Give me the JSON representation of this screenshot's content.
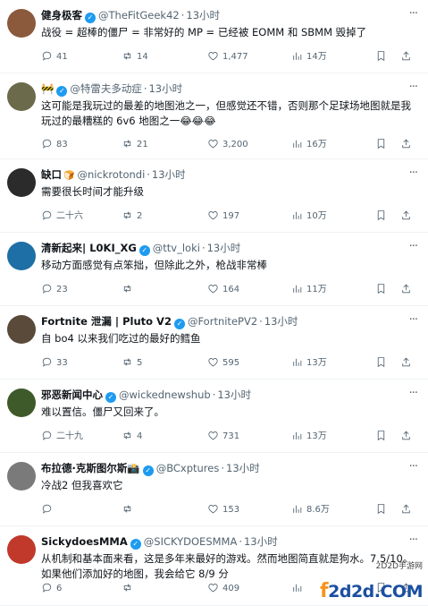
{
  "tweets": [
    {
      "name": "健身极客",
      "verified": true,
      "badge": "",
      "handle": "@TheFitGeek42",
      "time": "13小时",
      "text": "战役 = 超棒的僵尸 = 非常好的 MP = 已经被 EOMM 和 SBMM 毁掉了",
      "replies": "41",
      "retweets": "14",
      "likes": "1,477",
      "views": "14万",
      "avatar_color": "#8b5a3c"
    },
    {
      "name": "🚧",
      "verified": true,
      "badge": "",
      "handle": "@特雷夫多动症",
      "time": "13小时",
      "text": "这可能是我玩过的最差的地图池之一，但感觉还不错，否则那个足球场地图就是我玩过的最糟糕的 6v6 地图之一😂😂😂",
      "replies": "83",
      "retweets": "21",
      "likes": "3,200",
      "views": "16万",
      "avatar_color": "#6b6a4a"
    },
    {
      "name": "缺口",
      "verified": false,
      "badge": "🍞",
      "handle": "@nickrotondi",
      "time": "13小时",
      "text": "需要很长时间才能升级",
      "replies": "二十六",
      "retweets": "2",
      "likes": "197",
      "views": "10万",
      "avatar_color": "#2b2b2b"
    },
    {
      "name": "清新起来| L0KI_XG",
      "verified": true,
      "badge": "",
      "handle": "@ttv_loki",
      "time": "13小时",
      "text": "移动方面感觉有点笨拙，但除此之外，枪战非常棒",
      "replies": "23",
      "retweets": "",
      "likes": "164",
      "views": "11万",
      "avatar_color": "#1d6fa5"
    },
    {
      "name": "Fortnite 泄漏 | Pluto V2",
      "verified": true,
      "badge": "",
      "handle": "@FortnitePV2",
      "time": "13小时",
      "text": "自 bo4 以来我们吃过的最好的鳕鱼",
      "replies": "33",
      "retweets": "5",
      "likes": "595",
      "views": "13万",
      "avatar_color": "#5a4a3a"
    },
    {
      "name": "邪恶新闻中心",
      "verified": true,
      "badge": "",
      "handle": "@wickednewshub",
      "time": "13小时",
      "text": "难以置信。僵尸又回来了。",
      "replies": "二十九",
      "retweets": "4",
      "likes": "731",
      "views": "13万",
      "avatar_color": "#3f5a2a"
    },
    {
      "name": "布拉德·克斯图尔斯📸",
      "verified": true,
      "badge": "",
      "handle": "@BCxptures",
      "time": "13小时",
      "text": "冷战2 但我喜欢它",
      "replies": "",
      "retweets": "",
      "likes": "153",
      "views": "8.6万",
      "avatar_color": "#7a7a7a"
    },
    {
      "name": "SickydoesMMA",
      "verified": true,
      "badge": "",
      "handle": "@SICKYDOESMMA",
      "time": "13小时",
      "text": "从机制和基本面来看，这是多年来最好的游戏。然而地图简直就是狗水。7.5/10。如果他们添加好的地图，我会给它 8/9 分",
      "replies": "6",
      "retweets": "",
      "likes": "409",
      "views": "",
      "avatar_color": "#c0392b"
    }
  ],
  "watermark": {
    "site": "2D2D手游网",
    "logo_prefix": "f",
    "logo_text": "2d2d.COM"
  }
}
